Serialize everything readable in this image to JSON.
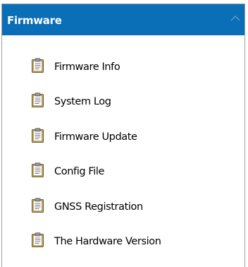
{
  "panel": {
    "title": "Firmware",
    "header_color": "#0a6fb6",
    "collapse_icon": "chevron-up-icon"
  },
  "menu": {
    "item_icon": "document-icon",
    "items": [
      {
        "id": "firmware-info",
        "label": "Firmware Info"
      },
      {
        "id": "system-log",
        "label": "System Log"
      },
      {
        "id": "firmware-update",
        "label": "Firmware Update"
      },
      {
        "id": "config-file",
        "label": "Config File"
      },
      {
        "id": "gnss-registration",
        "label": "GNSS Registration"
      },
      {
        "id": "hardware-version",
        "label": "The Hardware Version"
      }
    ]
  }
}
